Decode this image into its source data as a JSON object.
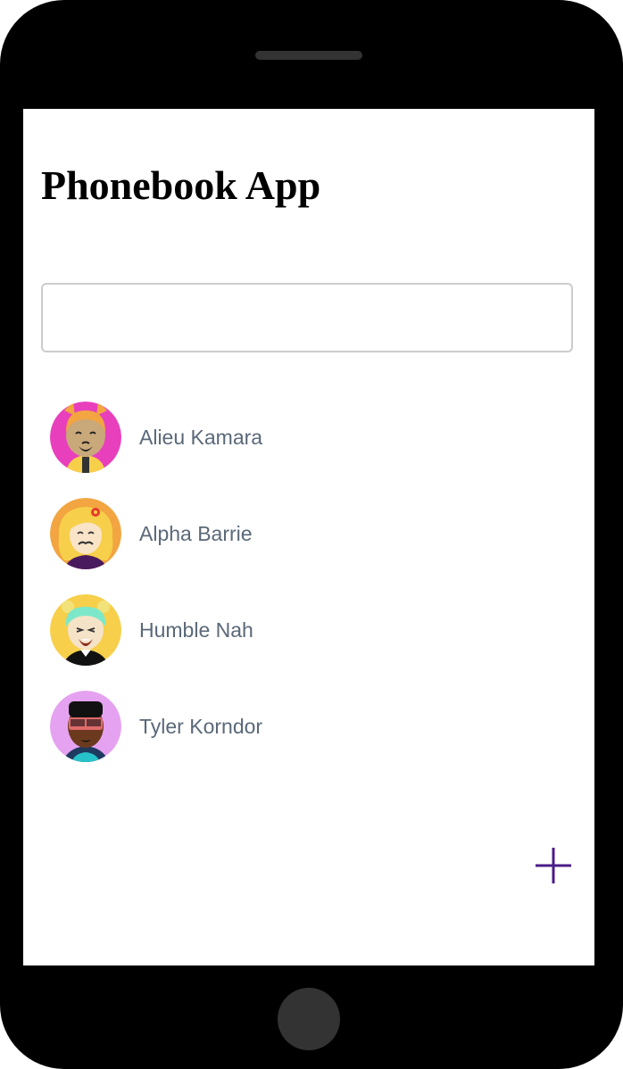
{
  "app": {
    "title": "Phonebook App"
  },
  "search": {
    "placeholder": "",
    "value": ""
  },
  "contacts": [
    {
      "name": "Alieu Kamara",
      "avatar_bg": "#e83fbd"
    },
    {
      "name": "Alpha Barrie",
      "avatar_bg": "#f2a540"
    },
    {
      "name": "Humble Nah",
      "avatar_bg": "#f7cf4a"
    },
    {
      "name": "Tyler Korndor",
      "avatar_bg": "#e5a2f0"
    }
  ],
  "add_button": {
    "icon": "plus-icon",
    "color": "#4b1c87"
  },
  "colors": {
    "contact_text": "#5a6878",
    "frame": "#000000",
    "screen": "#ffffff"
  }
}
